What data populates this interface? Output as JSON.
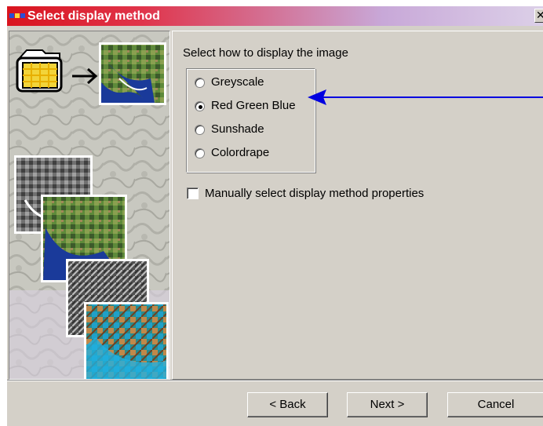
{
  "window": {
    "title": "Select display method",
    "title_icon": "dots-icon",
    "close_glyph": "✕"
  },
  "main": {
    "prompt": "Select how to display the image",
    "radios": [
      {
        "label": "Greyscale",
        "selected": false
      },
      {
        "label": "Red Green Blue",
        "selected": true
      },
      {
        "label": "Sunshade",
        "selected": false
      },
      {
        "label": "Colordrape",
        "selected": false
      }
    ],
    "checkbox": {
      "label": "Manually select display method properties",
      "checked": false
    }
  },
  "buttons": {
    "back": "< Back",
    "next": "Next >",
    "cancel": "Cancel"
  },
  "colors": {
    "title_start": "#d9141e",
    "title_end": "#dcd0e8",
    "dialog_bg": "#d4d0c8",
    "arrow": "#0000e0"
  }
}
